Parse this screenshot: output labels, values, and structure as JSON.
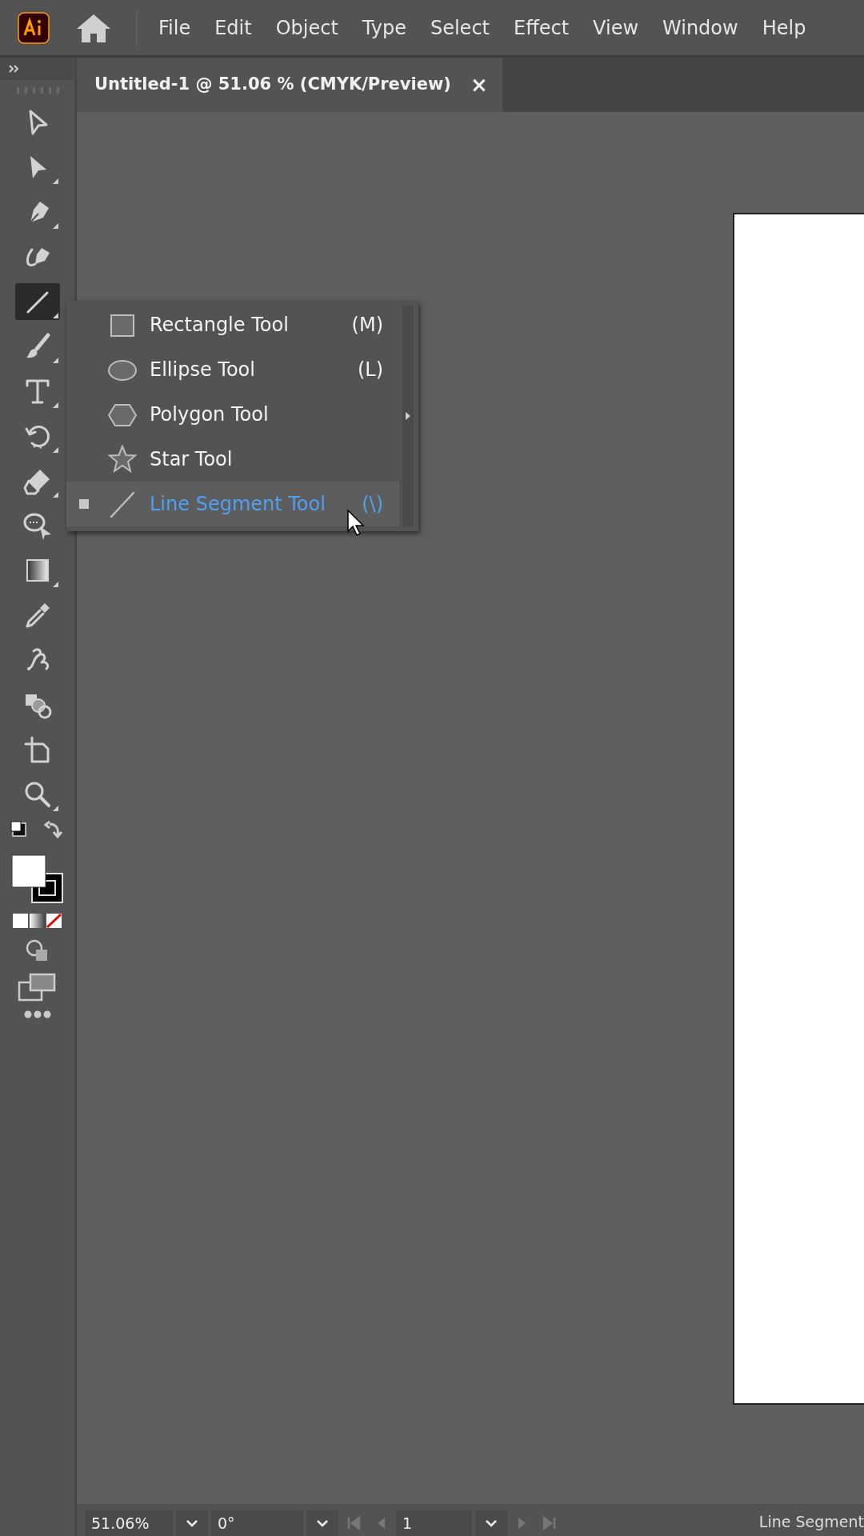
{
  "menu_bar": {
    "items": [
      "File",
      "Edit",
      "Object",
      "Type",
      "Select",
      "Effect",
      "View",
      "Window",
      "Help"
    ]
  },
  "document_tab": {
    "title": "Untitled-1 @ 51.06 % (CMYK/Preview)",
    "close": "×",
    "selected": true
  },
  "tools": [
    {
      "kind": "selection",
      "selected": false,
      "flyout": false
    },
    {
      "kind": "direct-selection",
      "selected": false,
      "flyout": true
    },
    {
      "kind": "pen",
      "selected": false,
      "flyout": true
    },
    {
      "kind": "curvature",
      "selected": false,
      "flyout": false
    },
    {
      "kind": "line",
      "selected": true,
      "flyout": true
    },
    {
      "kind": "paintbrush",
      "selected": false,
      "flyout": true
    },
    {
      "kind": "type",
      "selected": false,
      "flyout": true
    },
    {
      "kind": "rotate",
      "selected": false,
      "flyout": true
    },
    {
      "kind": "eraser",
      "selected": false,
      "flyout": true
    },
    {
      "kind": "shaper",
      "selected": false,
      "flyout": false
    },
    {
      "kind": "gradient",
      "selected": false,
      "flyout": true
    },
    {
      "kind": "eyedropper",
      "selected": false,
      "flyout": false
    },
    {
      "kind": "puppet",
      "selected": false,
      "flyout": false
    },
    {
      "kind": "shape-builder",
      "selected": false,
      "flyout": false
    },
    {
      "kind": "artboard",
      "selected": false,
      "flyout": false
    },
    {
      "kind": "zoom",
      "selected": false,
      "flyout": true
    }
  ],
  "flyout_menu": {
    "items": [
      {
        "kind": "rectangle",
        "label": "Rectangle Tool",
        "shortcut": "(M)",
        "selected": false
      },
      {
        "kind": "ellipse",
        "label": "Ellipse Tool",
        "shortcut": "(L)",
        "selected": false
      },
      {
        "kind": "polygon",
        "label": "Polygon Tool",
        "selected": false
      },
      {
        "kind": "star",
        "label": "Star Tool",
        "selected": false
      },
      {
        "kind": "line",
        "label": "Line Segment Tool",
        "shortcut": "(\\)",
        "selected": true
      }
    ]
  },
  "status_bar": {
    "zoom": "51.06%",
    "rotation": "0°",
    "artboard": "1",
    "current_tool": "Line Segment"
  }
}
